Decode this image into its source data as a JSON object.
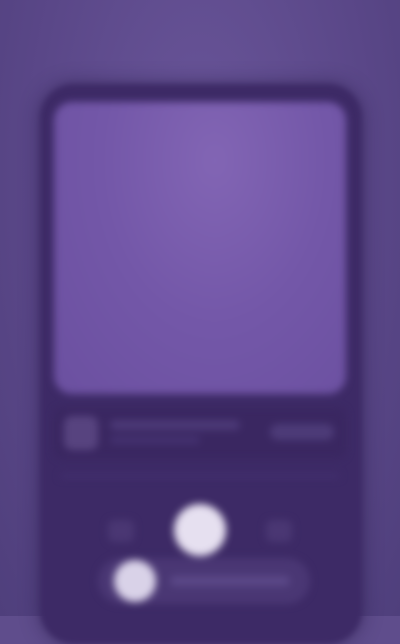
{
  "theme": {
    "background": "#5f4d8c",
    "frame": "#3d2a66",
    "artwork": "#7357a8",
    "play_button": "#e6e0f0"
  },
  "icons": {
    "previous": "skip-back-icon",
    "play": "play-icon",
    "next": "skip-forward-icon"
  }
}
